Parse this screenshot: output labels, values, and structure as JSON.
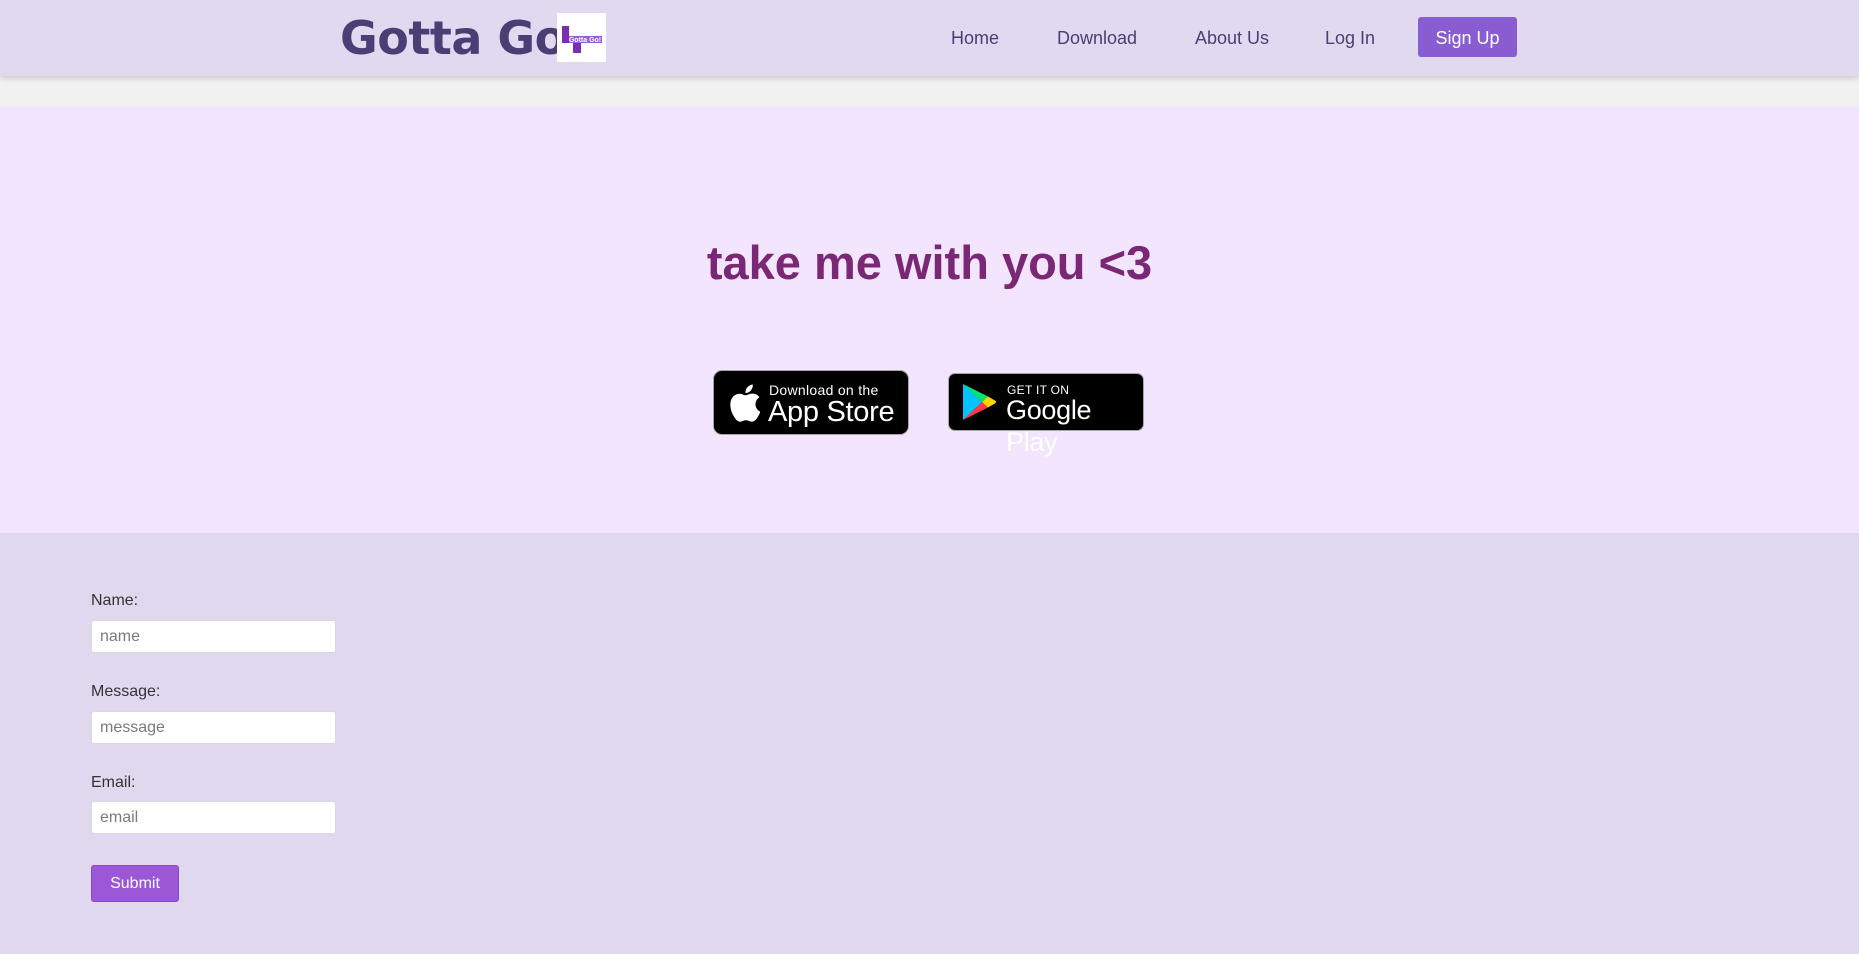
{
  "navbar": {
    "brand": "Gotta Go!",
    "logo_text": "Gotta Go!",
    "links": [
      "Home",
      "Download",
      "About Us",
      "Log In"
    ],
    "signup_label": "Sign Up"
  },
  "hero": {
    "tagline": "take me with you <3",
    "app_store": {
      "small": "Download on the",
      "big": "App Store",
      "icon": "apple-icon"
    },
    "google_play": {
      "small": "GET IT ON",
      "big": "Google Play",
      "icon": "google-play-icon"
    }
  },
  "contact": {
    "name_label": "Name:",
    "name_placeholder": "name",
    "message_label": "Message:",
    "message_placeholder": "message",
    "email_label": "Email:",
    "email_placeholder": "email",
    "submit_label": "Submit"
  },
  "colors": {
    "brand": "#4c3d74",
    "accent": "#8a5cd2",
    "tagline": "#7a2776",
    "hero_bg": "#f2e5fd",
    "page_bg": "#e0d8ef"
  }
}
